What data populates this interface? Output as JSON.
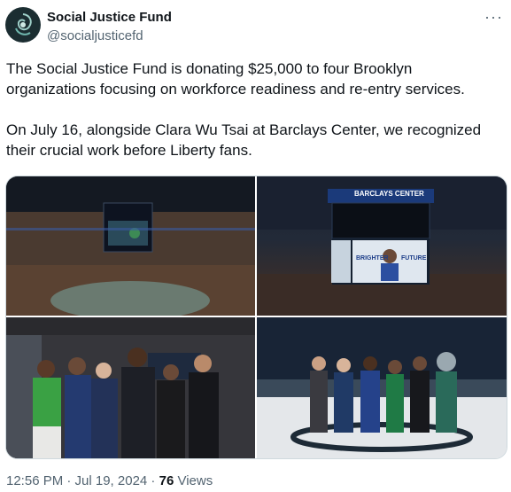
{
  "account": {
    "name": "Social Justice Fund",
    "handle": "@socialjusticefd"
  },
  "tweet": {
    "paragraph_1": "The Social Justice Fund is donating $25,000 to four Brooklyn organizations focusing on workforce readiness and re-entry services.",
    "paragraph_2": "On July 16, alongside Clara Wu Tsai at Barclays Center, we recognized their crucial work before Liberty fans."
  },
  "media": {
    "scoreboard_text": "BARCLAYS CENTER",
    "screen_left_text": "BRIGHTER",
    "screen_right_text": "FUTURE"
  },
  "meta": {
    "timestamp": "12:56 PM · Jul 19, 2024 · ",
    "views_count": "76",
    "views_label": " Views"
  },
  "icons": {
    "more": "more-icon",
    "avatar": "fund-logo-icon"
  }
}
